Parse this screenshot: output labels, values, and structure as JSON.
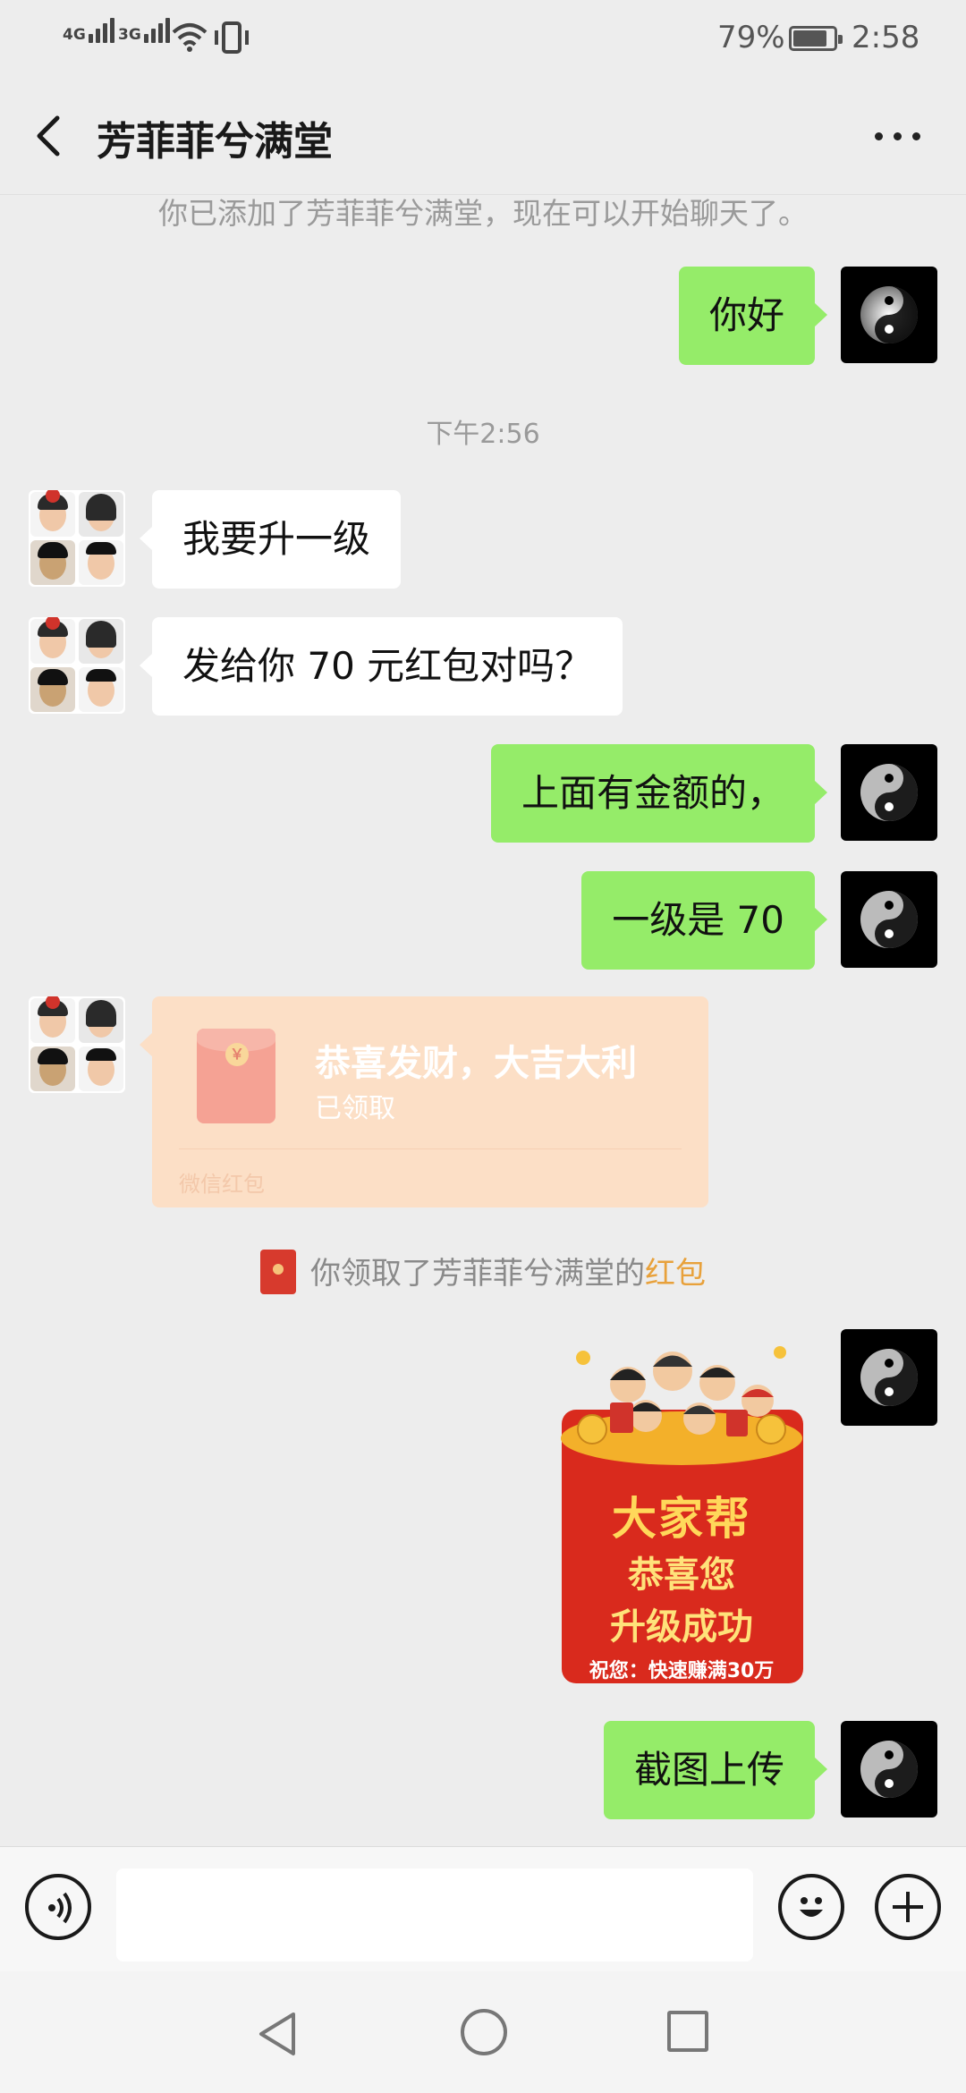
{
  "status_bar": {
    "network_1": "4G",
    "network_2": "3G",
    "battery": "79%",
    "time": "2:58",
    "icons": [
      "signal-icon",
      "wifi-icon",
      "vibrate-icon",
      "battery-icon"
    ]
  },
  "header": {
    "title": "芳菲菲兮满堂",
    "back_icon": "back-chevron-icon",
    "more_icon": "more-icon"
  },
  "chat": {
    "system_note": "你已添加了芳菲菲兮满堂，现在可以开始聊天了。",
    "timestamp": "下午2:56",
    "messages": [
      {
        "side": "right",
        "text": "你好"
      },
      {
        "side": "left",
        "text": "我要升一级"
      },
      {
        "side": "left",
        "text": "发给你 70 元红包对吗？"
      },
      {
        "side": "right",
        "text": "上面有金额的，"
      },
      {
        "side": "right",
        "text": "一级是 70"
      },
      {
        "side": "right",
        "text": "截图上传"
      }
    ],
    "red_packet": {
      "title": "恭喜发财，大吉大利",
      "status": "已领取",
      "footer": "微信红包",
      "coin_symbol": "￥"
    },
    "receipt_note": {
      "text": "你领取了芳菲菲兮满堂的",
      "link": "红包"
    },
    "sticker": {
      "line1": "大家帮",
      "line2": "恭喜您",
      "line3": "升级成功",
      "line4": "祝您：快速赚满30万"
    }
  },
  "input_bar": {
    "message_value": "",
    "icons": [
      "voice-icon",
      "emoji-icon",
      "plus-icon"
    ]
  },
  "nav_bar": {
    "icons": [
      "nav-back-icon",
      "nav-home-icon",
      "nav-recent-icon"
    ]
  },
  "colors": {
    "background": "#ededed",
    "bubble_right": "#95ec69",
    "bubble_left": "#ffffff",
    "red_packet": "#fcdfc6",
    "link": "#e8a13b"
  }
}
